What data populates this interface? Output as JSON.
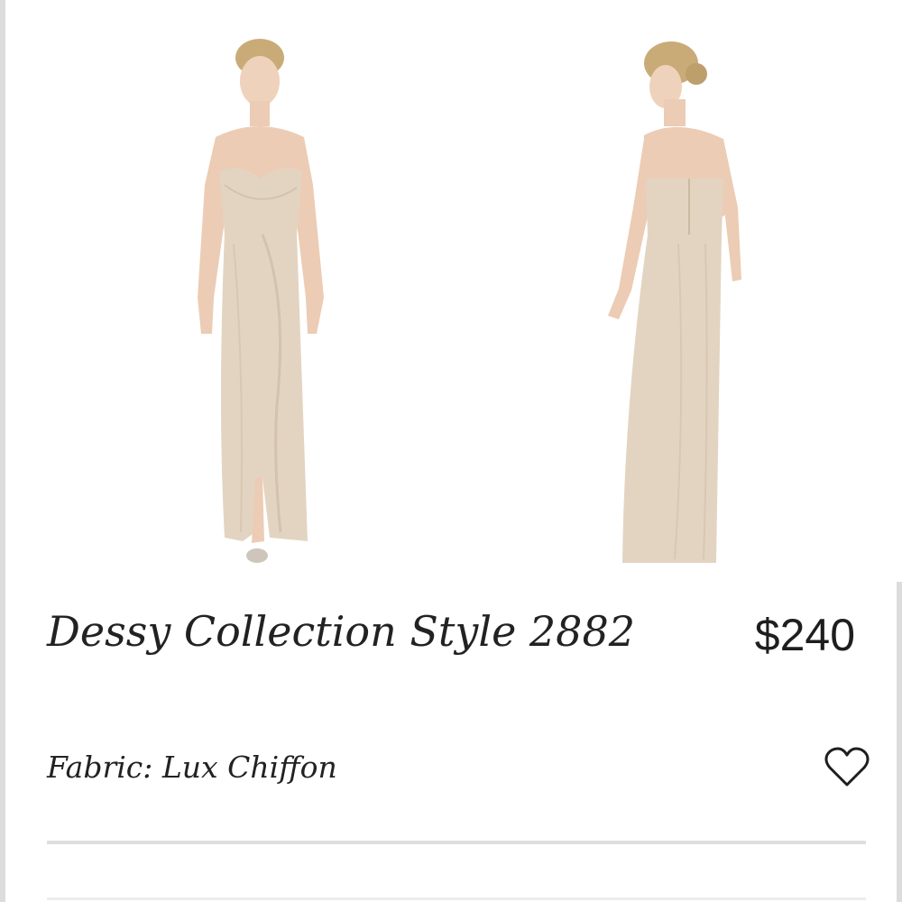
{
  "product": {
    "title": "Dessy Collection Style 2882",
    "price": "$240",
    "fabric": "Fabric: Lux Chiffon",
    "dress_color": "#e3d4c2",
    "images": [
      {
        "view": "front",
        "alt": "front-view-photo"
      },
      {
        "view": "back",
        "alt": "back-view-photo"
      }
    ]
  },
  "icons": {
    "favorite": "heart-outline-icon"
  }
}
